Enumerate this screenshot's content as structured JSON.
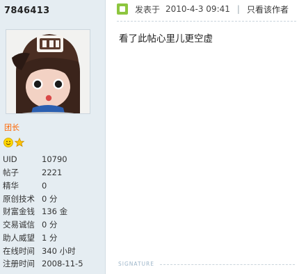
{
  "user": {
    "username": "7846413",
    "rank": "团长",
    "profile": [
      {
        "key": "UID",
        "value": "10790"
      },
      {
        "key": "帖子",
        "value": "2221"
      },
      {
        "key": "精华",
        "value": "0"
      },
      {
        "key": "原创技术",
        "value": "0 分"
      },
      {
        "key": "财富金钱",
        "value": "136 金"
      },
      {
        "key": "交易诚信",
        "value": "0 分"
      },
      {
        "key": "助人威望",
        "value": "1 分"
      },
      {
        "key": "在线时间",
        "value": "340 小时"
      },
      {
        "key": "注册时间",
        "value": "2008-11-5"
      }
    ]
  },
  "post": {
    "posted_label": "发表于",
    "date": "2010-4-3 09:41",
    "separator": "|",
    "author_only": "只看该作者",
    "content": "看了此帖心里儿更空虚",
    "signature_label": "SIGNATURE"
  },
  "colors": {
    "panel_bg": "#e5edf2",
    "rank": "#ff6600",
    "post_icon": "#8dc63f",
    "signature": "#9cb5c9"
  },
  "icons": {
    "level_icons": [
      "smiley-icon",
      "star-icon"
    ],
    "post_icon": "online-status-icon"
  }
}
